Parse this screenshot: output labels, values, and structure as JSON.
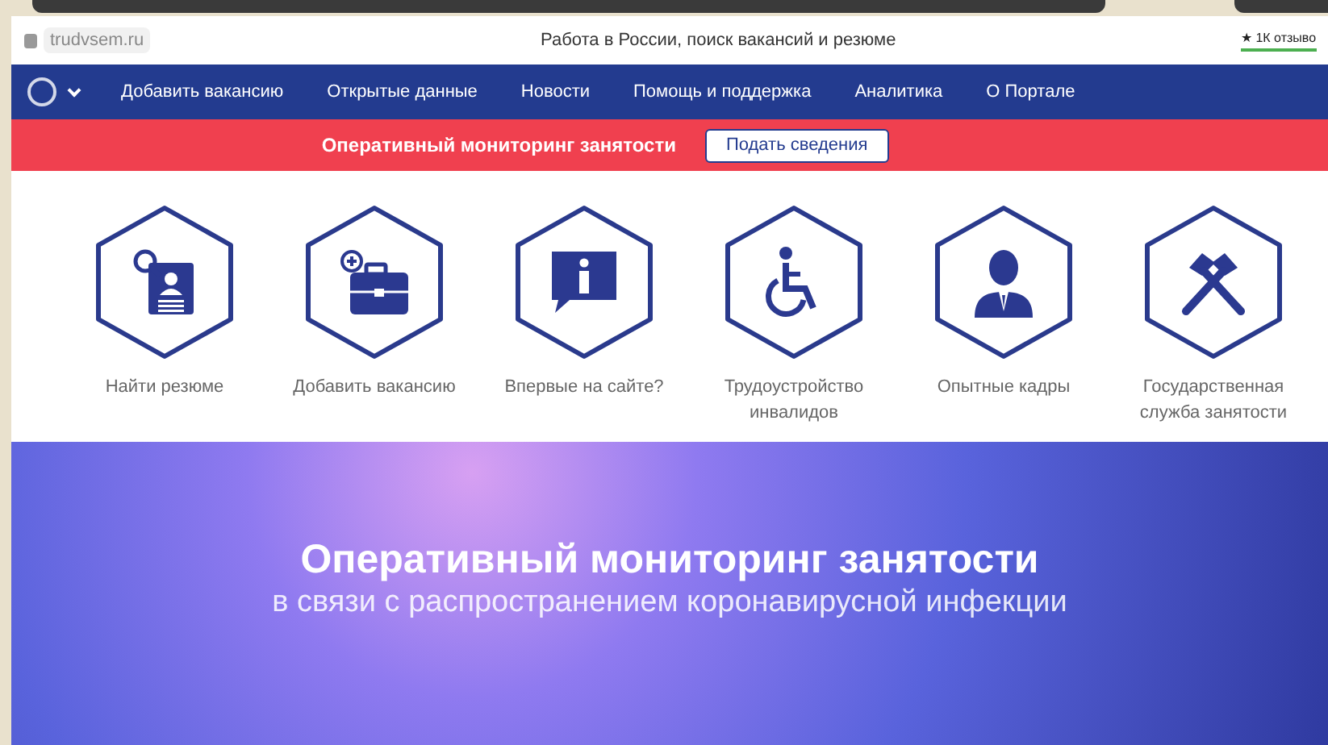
{
  "browser": {
    "url": "trudvsem.ru",
    "title": "Работа в России, поиск вакансий и резюме",
    "reviews": "★ 1К отзыво"
  },
  "nav": {
    "items": [
      "Добавить вакансию",
      "Открытые данные",
      "Новости",
      "Помощь и поддержка",
      "Аналитика",
      "О Портале"
    ]
  },
  "alert_bar": {
    "text": "Оперативный мониторинг занятости",
    "button": "Подать сведения"
  },
  "tiles": [
    {
      "kind": "resume",
      "label": "Найти резюме"
    },
    {
      "kind": "briefcase",
      "label": "Добавить вакансию"
    },
    {
      "kind": "info",
      "label": "Впервые на сайте?"
    },
    {
      "kind": "wheelchair",
      "label": "Трудоустройство инвалидов"
    },
    {
      "kind": "person",
      "label": "Опытные кадры"
    },
    {
      "kind": "hammers",
      "label": "Государственная служба занятости"
    }
  ],
  "banner": {
    "title": "Оперативный мониторинг занятости",
    "subtitle": "в связи с распространением коронавирусной инфекции"
  }
}
